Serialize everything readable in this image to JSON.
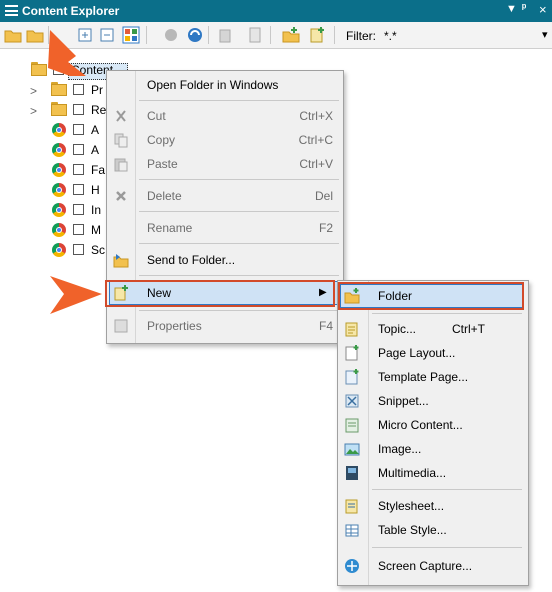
{
  "window": {
    "title": "Content Explorer",
    "dropdown_glyph": "▼",
    "pin_glyph": "ᵖ",
    "close_glyph": "×"
  },
  "toolbar": {
    "filter_label": "Filter:",
    "filter_value": "*.*",
    "filter_dropdown_glyph": "▾"
  },
  "tree": {
    "root_label": "Content",
    "items": [
      {
        "label": "Pr",
        "type": "folder",
        "expandable": true
      },
      {
        "label": "Re",
        "type": "folder",
        "expandable": true
      },
      {
        "label": "A",
        "type": "chrome"
      },
      {
        "label": "A",
        "type": "chrome"
      },
      {
        "label": "Fa",
        "type": "chrome"
      },
      {
        "label": "H",
        "type": "chrome"
      },
      {
        "label": "In",
        "type": "chrome"
      },
      {
        "label": "M",
        "type": "chrome"
      },
      {
        "label": "Sc",
        "type": "chrome"
      }
    ],
    "expander_glyph": ">"
  },
  "context_menu": {
    "open_folder": "Open Folder in Windows",
    "cut": {
      "label": "Cut",
      "shortcut": "Ctrl+X"
    },
    "copy": {
      "label": "Copy",
      "shortcut": "Ctrl+C"
    },
    "paste": {
      "label": "Paste",
      "shortcut": "Ctrl+V"
    },
    "delete": {
      "label": "Delete",
      "shortcut": "Del"
    },
    "rename": {
      "label": "Rename",
      "shortcut": "F2"
    },
    "send_to_folder": "Send to Folder...",
    "new": "New",
    "submenu_glyph": "▶",
    "properties": {
      "label": "Properties",
      "shortcut": "F4"
    }
  },
  "new_submenu": {
    "folder": "Folder",
    "topic": {
      "label": "Topic...",
      "shortcut": "Ctrl+T"
    },
    "page_layout": "Page Layout...",
    "template_page": "Template Page...",
    "snippet": "Snippet...",
    "micro_content": "Micro Content...",
    "image": "Image...",
    "multimedia": "Multimedia...",
    "stylesheet": "Stylesheet...",
    "table_style": "Table Style...",
    "screen_capture": "Screen Capture..."
  },
  "colors": {
    "titlebar": "#0b6f8a",
    "annotation_red": "#d24a2a",
    "annotation_orange": "#f0622a",
    "highlight": "#cfe2f5"
  }
}
